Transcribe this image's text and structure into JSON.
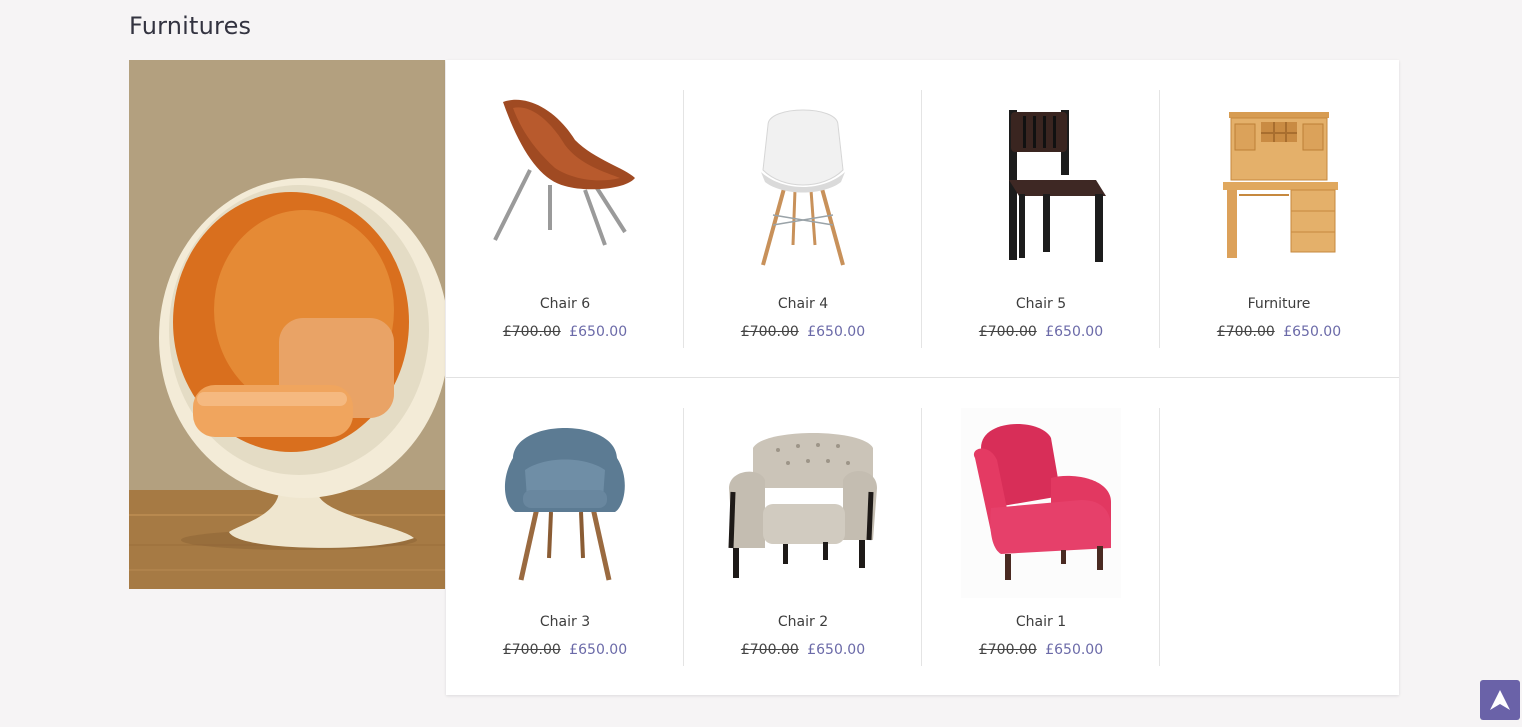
{
  "section": {
    "title": "Furnitures"
  },
  "banner": {
    "icon": "ball-chair-image"
  },
  "products": [
    {
      "name": "Chair 6",
      "old_price": "£700.00",
      "new_price": "£650.00",
      "icon": "lounge-chair-image"
    },
    {
      "name": "Chair 4",
      "old_price": "£700.00",
      "new_price": "£650.00",
      "icon": "white-shell-chair-image"
    },
    {
      "name": "Chair 5",
      "old_price": "£700.00",
      "new_price": "£650.00",
      "icon": "black-wooden-chair-image"
    },
    {
      "name": "Furniture",
      "old_price": "£700.00",
      "new_price": "£650.00",
      "icon": "wooden-desk-image"
    },
    {
      "name": "Chair 3",
      "old_price": "£700.00",
      "new_price": "£650.00",
      "icon": "blue-armchair-image"
    },
    {
      "name": "Chair 2",
      "old_price": "£700.00",
      "new_price": "£650.00",
      "icon": "tufted-armchair-image"
    },
    {
      "name": "Chair 1",
      "old_price": "£700.00",
      "new_price": "£650.00",
      "icon": "pink-armchair-image"
    }
  ],
  "colors": {
    "accent": "#6a62a8",
    "sale_price": "#6b6aa8",
    "background": "#f6f4f5"
  },
  "back_to_top": {
    "icon": "arrow-up-icon"
  }
}
